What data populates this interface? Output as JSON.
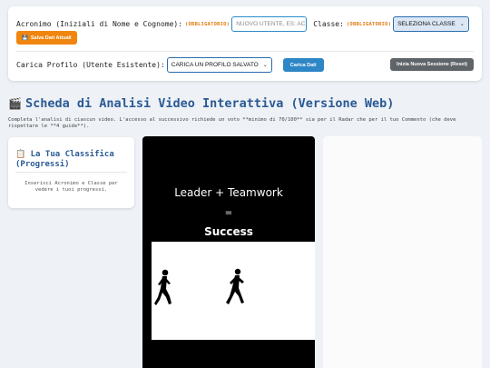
{
  "form": {
    "acronym_label": "Acronimo (Iniziali di Nome e Cognome):",
    "required": "(OBBLIGATORIO)",
    "acronym_placeholder": "NUOVO UTENTE, ES: AC",
    "class_label": "Classe:",
    "class_select": "SELEZIONA CLASSE",
    "save_button": "Salva Dati Attuali",
    "save_icon": "floppy-icon",
    "load_label": "Carica Profilo (Utente Esistente):",
    "profile_select": "CARICA UN PROFILO SALVATO",
    "load_button": "Carica Dati",
    "reset_button": "Inizia Nuova Sessione (Reset)"
  },
  "main": {
    "title": "Scheda di Analisi Video Interattiva (Versione Web)",
    "title_icon": "clapper-icon",
    "description": "Completa l'analisi di ciascun video. L'accesso al successivo richiede un voto **minimo di 70/100** sia per il Radar che per il tuo Commento (che deve rispettare le **4 guide**)."
  },
  "sidebar": {
    "title": "La Tua Classifica (Progressi)",
    "title_icon": "clipboard-icon",
    "hint": "Inserisci Acronimo e Classe per vedere i tuoi progressi."
  },
  "video": {
    "line1": "Leader + Teamwork",
    "line2": "=",
    "line3": "Success"
  },
  "colors": {
    "accent": "#2a5a95",
    "required": "#e07a10",
    "save_button": "#f0850f",
    "load_button": "#2d86c6",
    "reset_button": "#5f6469"
  }
}
